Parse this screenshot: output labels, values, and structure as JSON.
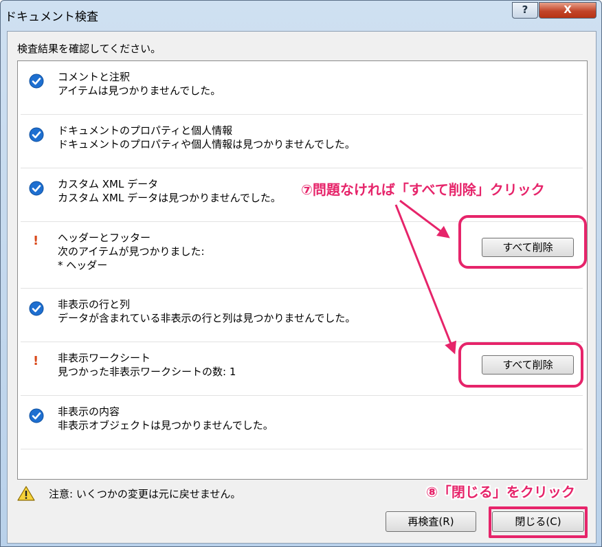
{
  "window": {
    "title": "ドキュメント検査",
    "help_label": "?",
    "close_label": "X"
  },
  "instruction": "検査結果を確認してください。",
  "items": [
    {
      "status": "ok",
      "title": "コメントと注釈",
      "lines": [
        "アイテムは見つかりませんでした。"
      ]
    },
    {
      "status": "ok",
      "title": "ドキュメントのプロパティと個人情報",
      "lines": [
        "ドキュメントのプロパティや個人情報は見つかりませんでした。"
      ]
    },
    {
      "status": "ok",
      "title": "カスタム XML データ",
      "lines": [
        "カスタム XML データは見つかりませんでした。"
      ]
    },
    {
      "status": "warning",
      "title": "ヘッダーとフッター",
      "lines": [
        "次のアイテムが見つかりました:",
        "* ヘッダー"
      ],
      "button": "すべて削除"
    },
    {
      "status": "ok",
      "title": "非表示の行と列",
      "lines": [
        "データが含まれている非表示の行と列は見つかりませんでした。"
      ]
    },
    {
      "status": "warning",
      "title": "非表示ワークシート",
      "lines": [
        "見つかった非表示ワークシートの数: 1"
      ],
      "button": "すべて削除"
    },
    {
      "status": "ok",
      "title": "非表示の内容",
      "lines": [
        "非表示オブジェクトは見つかりませんでした。"
      ]
    }
  ],
  "warning_note": "注意: いくつかの変更は元に戻せません。",
  "buttons": {
    "reinspect": "再検査(R)",
    "close": "閉じる(C)"
  },
  "annotations": {
    "step7": "⑦問題なければ「すべて削除」クリック",
    "step8": "⑧「閉じる」をクリック"
  },
  "colors": {
    "accent": "#e6246a",
    "check": "#1e6fd0",
    "warning": "#d9491b"
  }
}
